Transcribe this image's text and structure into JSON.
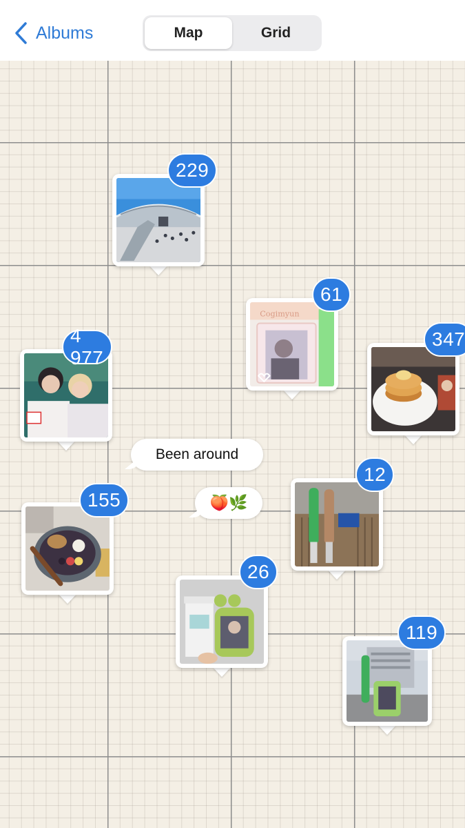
{
  "header": {
    "back_label": "Albums",
    "segments": [
      {
        "label": "Map",
        "selected": true
      },
      {
        "label": "Grid",
        "selected": false
      }
    ]
  },
  "pins": [
    {
      "name": "stadium",
      "count": "229"
    },
    {
      "name": "photocard-frame",
      "count": "61"
    },
    {
      "name": "friends-selfie",
      "count": "4 977"
    },
    {
      "name": "pancakes",
      "count": "347"
    },
    {
      "name": "acai-bowl",
      "count": "155"
    },
    {
      "name": "lightsticks",
      "count": "12"
    },
    {
      "name": "coffee-keychain",
      "count": "26"
    },
    {
      "name": "venue-lightstick",
      "count": "119"
    }
  ],
  "bubbles": {
    "label": "Been around",
    "emojis": "🍑🌿"
  },
  "colors": {
    "accent": "#2d7ce0",
    "map_background": "#f4efe5"
  }
}
